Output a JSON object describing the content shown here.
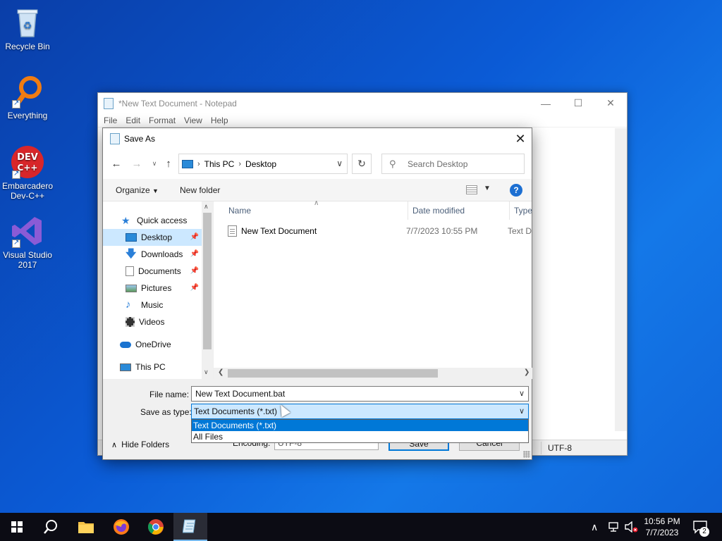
{
  "desktop": {
    "icons": [
      {
        "label": "Recycle Bin"
      },
      {
        "label": "Everything"
      },
      {
        "label": "Embarcadero Dev-C++"
      },
      {
        "label": "Visual Studio 2017"
      }
    ]
  },
  "notepad": {
    "title": "*New Text Document - Notepad",
    "menu": [
      "File",
      "Edit",
      "Format",
      "View",
      "Help"
    ],
    "status_encoding": "UTF-8"
  },
  "dialog": {
    "title": "Save As",
    "breadcrumb": [
      "This PC",
      "Desktop"
    ],
    "search_placeholder": "Search Desktop",
    "toolbar": {
      "organize": "Organize",
      "new_folder": "New folder",
      "help": "?"
    },
    "sidebar": [
      {
        "label": "Quick access"
      },
      {
        "label": "Desktop"
      },
      {
        "label": "Downloads"
      },
      {
        "label": "Documents"
      },
      {
        "label": "Pictures"
      },
      {
        "label": "Music"
      },
      {
        "label": "Videos"
      },
      {
        "label": "OneDrive"
      },
      {
        "label": "This PC"
      }
    ],
    "columns": {
      "name": "Name",
      "date": "Date modified",
      "type": "Type"
    },
    "files": [
      {
        "name": "New Text Document",
        "date": "7/7/2023 10:55 PM",
        "type": "Text D"
      }
    ],
    "form": {
      "file_name_label": "File name:",
      "file_name_value": "New Text Document.bat",
      "save_type_label": "Save as type:",
      "save_type_value": "Text Documents (*.txt)",
      "save_type_options": [
        "Text Documents (*.txt)",
        "All Files"
      ],
      "hide_folders": "Hide Folders",
      "encoding_label": "Encoding:",
      "encoding_value": "UTF-8",
      "save_button": "Save",
      "cancel_button": "Cancel"
    }
  },
  "taskbar": {
    "time": "10:56 PM",
    "date": "7/7/2023",
    "notification_count": "2"
  }
}
